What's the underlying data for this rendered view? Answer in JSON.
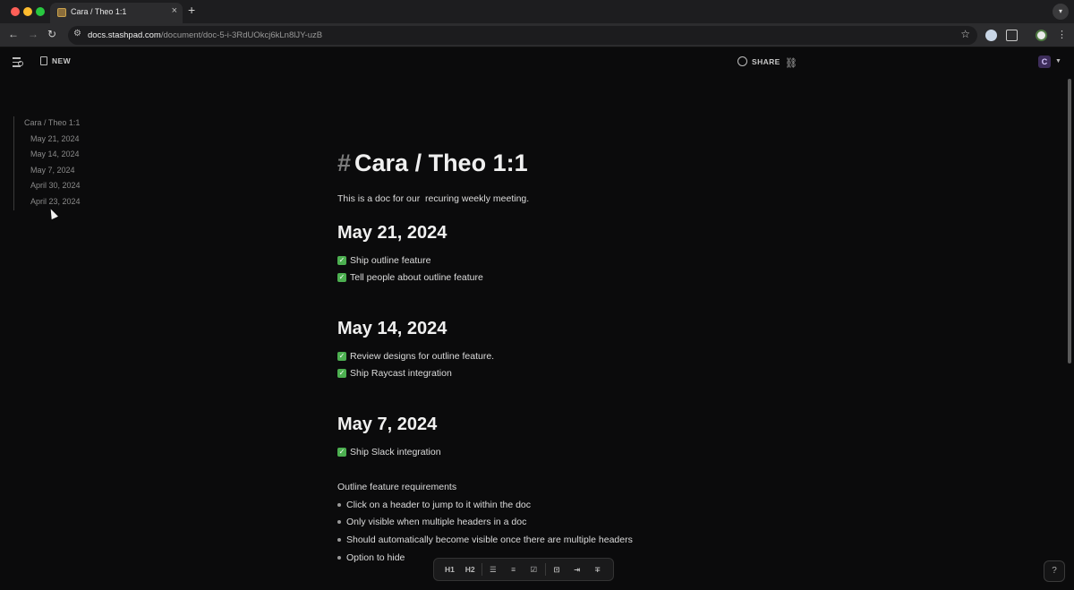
{
  "browser": {
    "tab_title": "Cara / Theo 1:1",
    "url_host": "docs.stashpad.com",
    "url_path": "/document/doc-5-i-3RdUOkcj6kLn8lJY-uzB"
  },
  "toolbar": {
    "new_label": "NEW",
    "share_label": "SHARE",
    "avatar_initial": "C"
  },
  "outline": {
    "title": "Cara / Theo 1:1",
    "items": [
      "May 21, 2024",
      "May 14, 2024",
      "May 7, 2024",
      "April 30, 2024",
      "April 23, 2024"
    ]
  },
  "doc": {
    "hash": "#",
    "title": "Cara / Theo 1:1",
    "intro": "This is a doc for our  recuring weekly meeting.",
    "sections": [
      {
        "heading": "May 21, 2024",
        "tasks": [
          "Ship outline feature",
          "Tell people about outline feature"
        ]
      },
      {
        "heading": "May 14, 2024",
        "tasks": [
          "Review designs for outline feature.",
          "Ship Raycast integration"
        ]
      },
      {
        "heading": "May 7, 2024",
        "tasks": [
          "Ship Slack integration"
        ],
        "note": "Outline feature requirements",
        "bullets": [
          "Click on a header to jump to it within the doc",
          "Only visible when multiple headers in a doc",
          "Should automatically become visible once there are multiple headers",
          "Option to hide"
        ]
      }
    ]
  },
  "format_bar": {
    "h1": "H1",
    "h2": "H2"
  },
  "help": "?",
  "colors": {
    "background": "#0b0b0c",
    "check": "#4caf50",
    "chrome": "#2c2c2e"
  }
}
